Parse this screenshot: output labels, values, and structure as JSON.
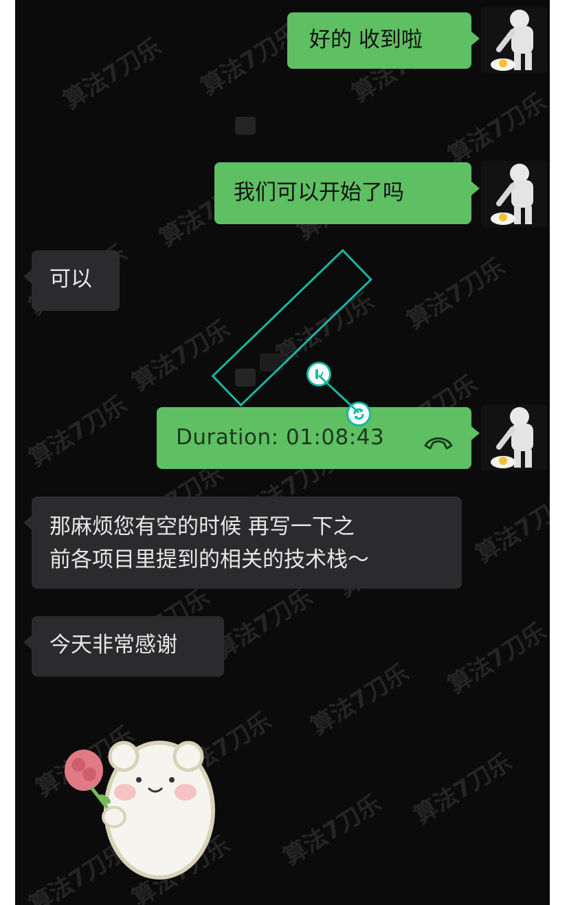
{
  "messages": [
    {
      "id": "m1",
      "side": "out",
      "text": "好的 收到啦"
    },
    {
      "id": "m2",
      "side": "out",
      "text": "我们可以开始了吗"
    },
    {
      "id": "m3",
      "side": "in",
      "text": "可以"
    },
    {
      "id": "m4",
      "side": "out",
      "text": "Duration: 01:08:43",
      "call_icon": "phone-hangup-icon"
    },
    {
      "id": "m5",
      "side": "in",
      "lines": [
        "那麻烦您有空的时候 再写一下之",
        "前各项目里提到的相关的技术栈～"
      ]
    },
    {
      "id": "m6",
      "side": "in",
      "text": "今天非常感谢"
    }
  ],
  "watermark_text": "算法7刀乐",
  "colors": {
    "background": "#0b0b0c",
    "outgoing_bubble": "#5fbf63",
    "incoming_bubble": "#2b2b2d",
    "annotation": "#17b9a0"
  },
  "icons": {
    "avatar": "astronaut-avatar-icon",
    "sticker": "bear-with-rose-sticker-icon",
    "call": "phone-hangup-icon",
    "rotate_handle": "rotate-icon",
    "resize_handle": "pen-icon"
  }
}
